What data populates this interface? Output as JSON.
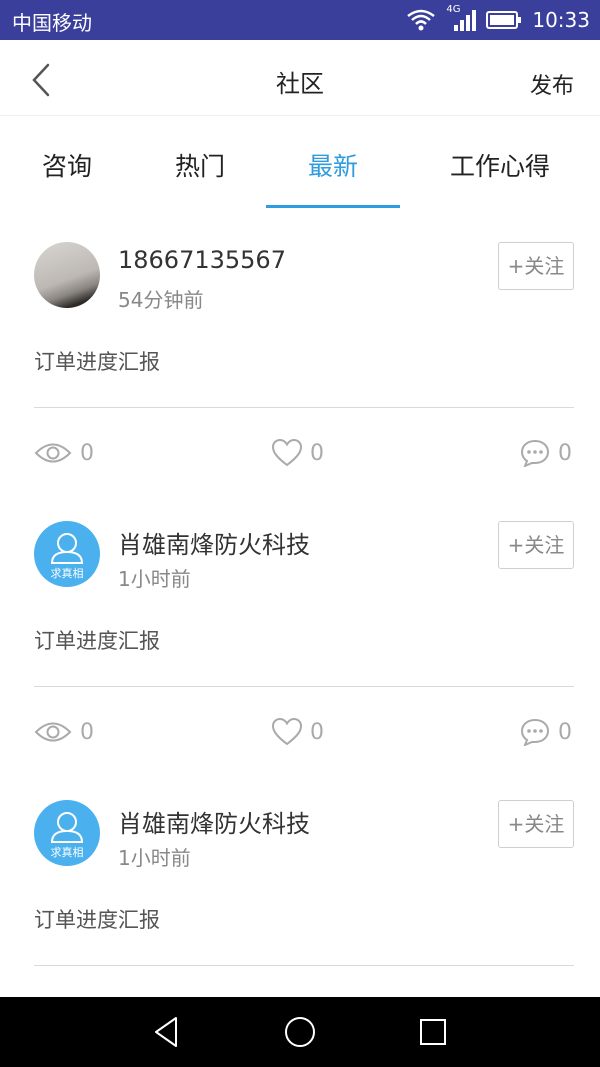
{
  "status_bar": {
    "carrier": "中国移动",
    "network": "4G",
    "time": "10:33"
  },
  "header": {
    "title": "社区",
    "publish_label": "发布"
  },
  "tabs": [
    {
      "label": "咨询",
      "active": false
    },
    {
      "label": "热门",
      "active": false
    },
    {
      "label": "最新",
      "active": true
    },
    {
      "label": "工作心得",
      "active": false
    }
  ],
  "colors": {
    "status_bar_bg": "#3a3f9c",
    "accent": "#2f9cdf",
    "avatar_default": "#4ab0ee",
    "separator": "#f2f4f7"
  },
  "posts": [
    {
      "user": "18667135567",
      "time": "54分钟前",
      "follow_label": "+关注",
      "content": "订单进度汇报",
      "views": "0",
      "likes": "0",
      "comments": "0",
      "avatar": "photo"
    },
    {
      "user": "肖雄南烽防火科技",
      "time": "1小时前",
      "follow_label": "+关注",
      "content": "订单进度汇报",
      "views": "0",
      "likes": "0",
      "comments": "0",
      "avatar": "default",
      "avatar_text": "求真相"
    },
    {
      "user": "肖雄南烽防火科技",
      "time": "1小时前",
      "follow_label": "+关注",
      "content": "订单进度汇报",
      "avatar": "default",
      "avatar_text": "求真相"
    }
  ]
}
